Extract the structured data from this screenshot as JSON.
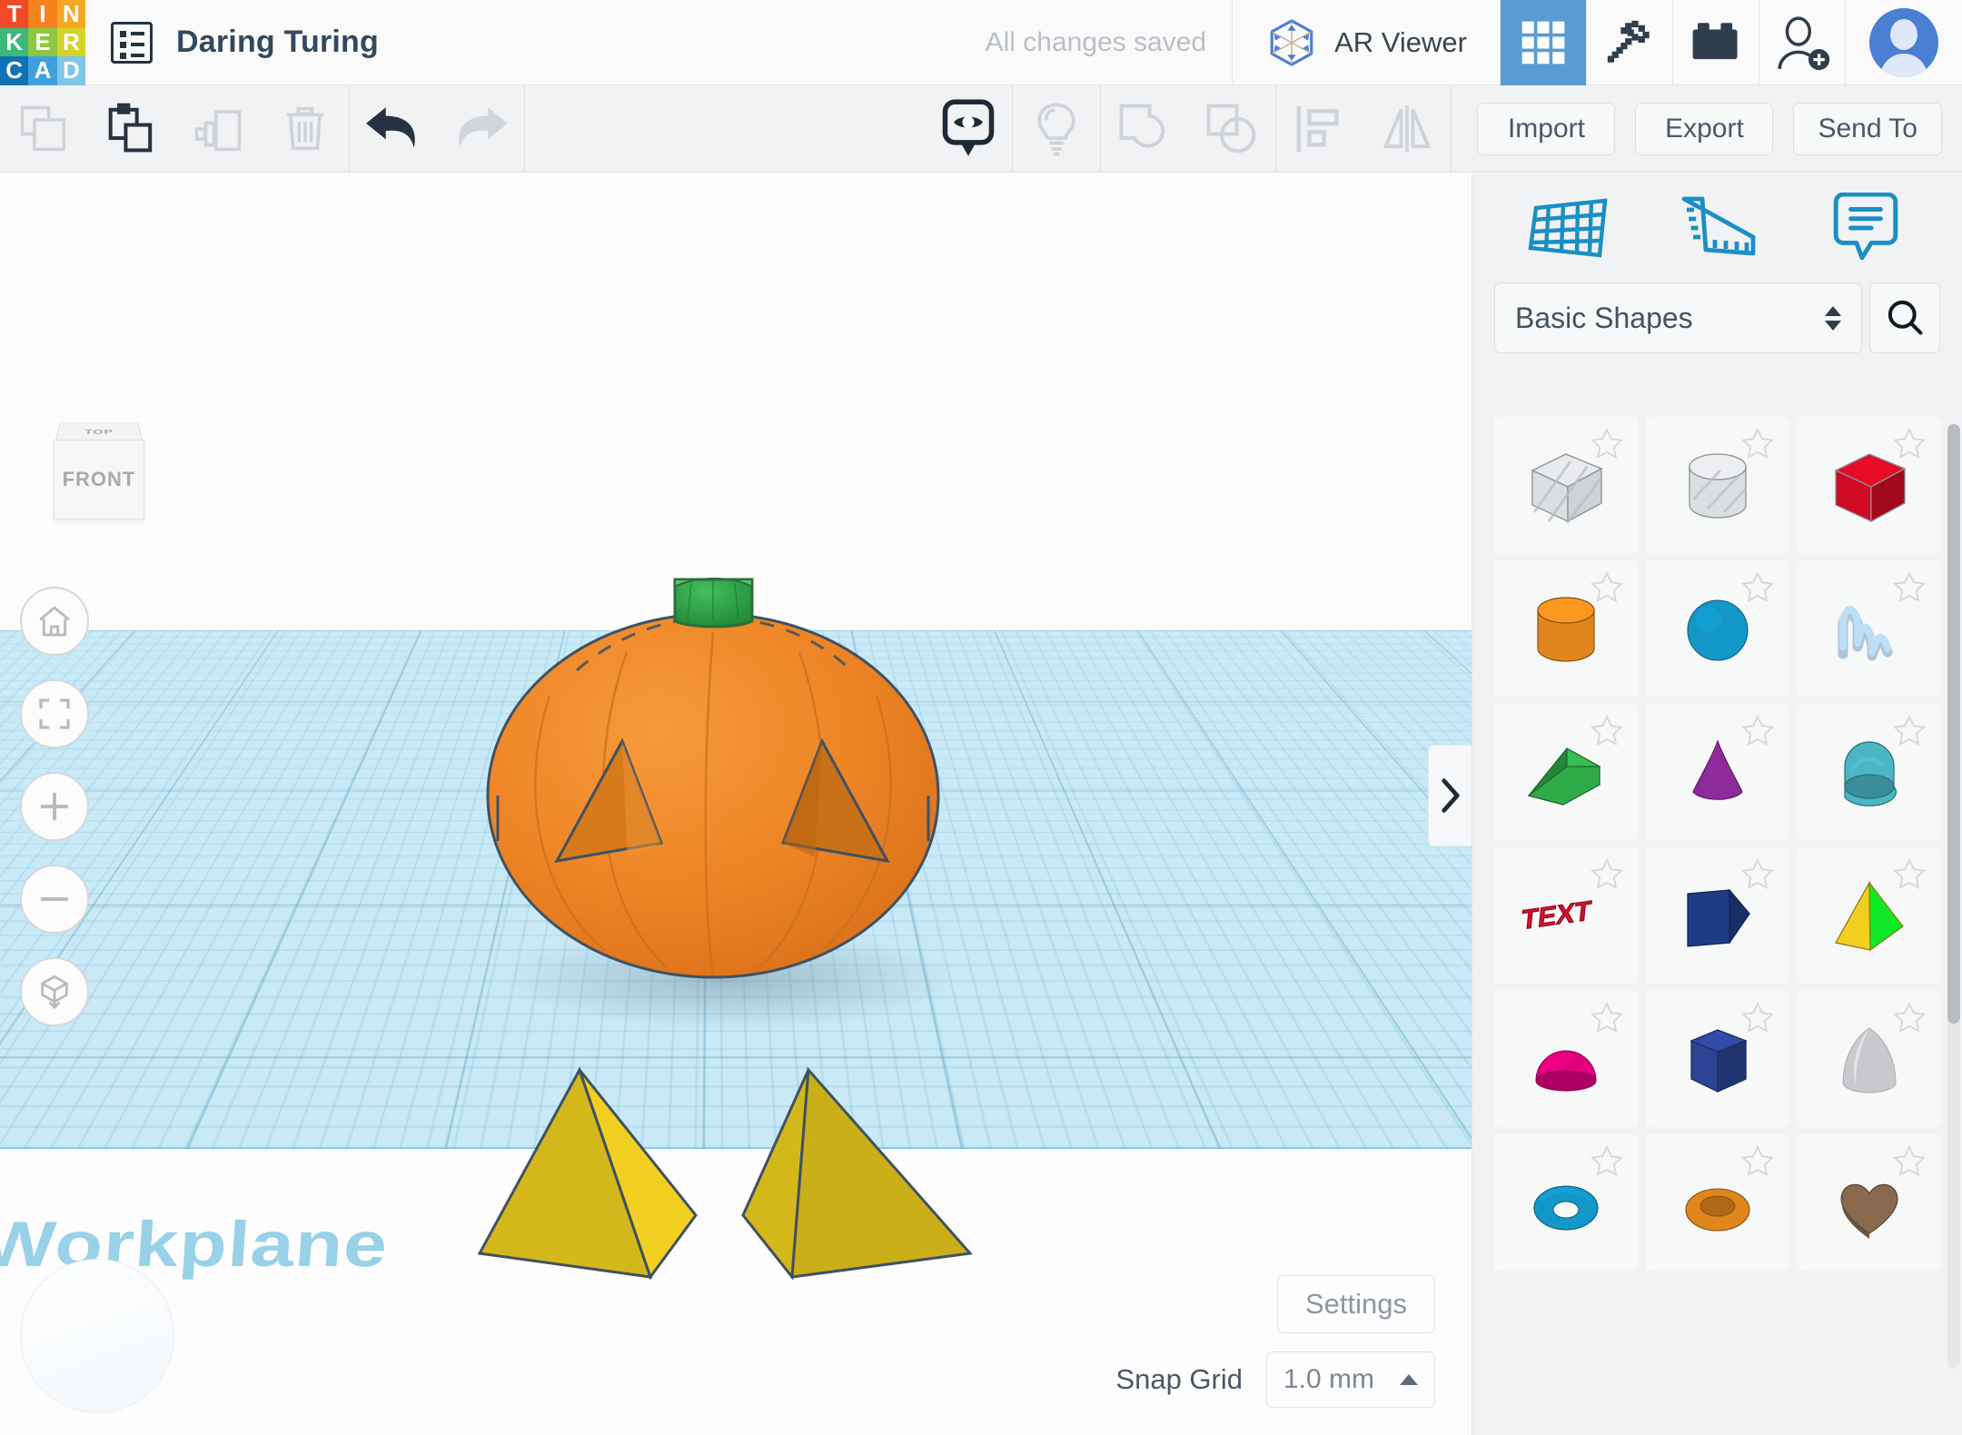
{
  "app": {
    "logo_tiles": [
      {
        "letter": "T",
        "color": "#f04b29"
      },
      {
        "letter": "I",
        "color": "#f7821e"
      },
      {
        "letter": "N",
        "color": "#f5a623"
      },
      {
        "letter": "K",
        "color": "#3cb878"
      },
      {
        "letter": "E",
        "color": "#8dc63f"
      },
      {
        "letter": "R",
        "color": "#d4d32a"
      },
      {
        "letter": "C",
        "color": "#0f72b5"
      },
      {
        "letter": "A",
        "color": "#3fa0db"
      },
      {
        "letter": "D",
        "color": "#7fc6e8"
      }
    ],
    "accent_blue": "#1b8fc4",
    "highlight_blue": "#5b9bd5"
  },
  "header": {
    "project_title": "Daring Turing",
    "save_status": "All changes saved",
    "ar_viewer_label": "AR Viewer",
    "icons": {
      "menu": "list-menu-icon",
      "ar": "ar-viewer-icon",
      "blocks": "blocks-grid-icon",
      "minecraft": "minecraft-pickaxe-icon",
      "lego": "lego-brick-icon",
      "add_user": "add-user-icon",
      "avatar": "user-avatar"
    }
  },
  "toolbar": {
    "left_tools": [
      {
        "name": "copy-icon",
        "enabled": false
      },
      {
        "name": "paste-icon",
        "enabled": true
      },
      {
        "name": "duplicate-icon",
        "enabled": false
      },
      {
        "name": "delete-icon",
        "enabled": false
      }
    ],
    "history_tools": [
      {
        "name": "undo-icon",
        "enabled": true
      },
      {
        "name": "redo-icon",
        "enabled": false
      }
    ],
    "view_tools": [
      {
        "name": "show-hide-icon",
        "enabled": true
      },
      {
        "name": "light-bulb-icon",
        "enabled": false
      }
    ],
    "group_tools": [
      {
        "name": "group-icon",
        "enabled": false
      },
      {
        "name": "ungroup-icon",
        "enabled": false
      }
    ],
    "align_tools": [
      {
        "name": "align-icon",
        "enabled": false
      },
      {
        "name": "mirror-icon",
        "enabled": false
      }
    ],
    "import_label": "Import",
    "export_label": "Export",
    "send_to_label": "Send To"
  },
  "canvas": {
    "view_cube": {
      "top_face": "TOP",
      "front_face": "FRONT"
    },
    "workplane_label": "Workplane",
    "nav_buttons": [
      {
        "name": "home-view-icon"
      },
      {
        "name": "fit-to-view-icon"
      },
      {
        "name": "zoom-in-icon"
      },
      {
        "name": "zoom-out-icon"
      },
      {
        "name": "orthographic-toggle-icon"
      }
    ],
    "objects": [
      {
        "name": "pumpkin",
        "body_color": "#ef8526",
        "stem_color": "#2fa84a",
        "features": "two triangular eye holes"
      },
      {
        "name": "pyramid-left",
        "color": "#f2d021"
      },
      {
        "name": "pyramid-right",
        "color": "#d4b81b"
      }
    ],
    "settings_label": "Settings",
    "snap_grid_label": "Snap Grid",
    "snap_grid_value": "1.0 mm",
    "collapse_icon": "chevron-right-icon"
  },
  "panel": {
    "tabs": [
      {
        "name": "workplane-tab",
        "icon": "workplane-grid-icon"
      },
      {
        "name": "ruler-tab",
        "icon": "ruler-icon"
      },
      {
        "name": "notes-tab",
        "icon": "notes-comment-icon"
      }
    ],
    "category_value": "Basic Shapes",
    "search_icon": "search-icon",
    "shapes": [
      {
        "label": "Box Hole",
        "kind": "hole-box",
        "color": "#d7dadd"
      },
      {
        "label": "Cylinder Hole",
        "kind": "hole-cylinder",
        "color": "#d7dadd"
      },
      {
        "label": "Box",
        "kind": "box",
        "color": "#cf0a24"
      },
      {
        "label": "Cylinder",
        "kind": "cylinder",
        "color": "#e0861c"
      },
      {
        "label": "Sphere",
        "kind": "sphere",
        "color": "#1397c8"
      },
      {
        "label": "Scribble",
        "kind": "scribble",
        "color": "#aac6db"
      },
      {
        "label": "Roof",
        "kind": "wedge",
        "color": "#2fab49"
      },
      {
        "label": "Cone",
        "kind": "cone",
        "color": "#8e2a9a"
      },
      {
        "label": "Tube",
        "kind": "halftube",
        "color": "#4ab6c4"
      },
      {
        "label": "Text",
        "kind": "text",
        "color": "#d6112a"
      },
      {
        "label": "Polygon Wedge",
        "kind": "polyslab",
        "color": "#1f3b86"
      },
      {
        "label": "Pyramid",
        "kind": "pyramid",
        "color": "#f2d021"
      },
      {
        "label": "Half Sphere",
        "kind": "halfsphere",
        "color": "#e3007f"
      },
      {
        "label": "Hexagon Prism",
        "kind": "hexprism",
        "color": "#2b4494"
      },
      {
        "label": "Paraboloid",
        "kind": "paraboloid",
        "color": "#c7c9cc"
      },
      {
        "label": "Torus",
        "kind": "torus",
        "color": "#1397c8"
      },
      {
        "label": "Round Roof",
        "kind": "ring",
        "color": "#e0861c"
      },
      {
        "label": "Heart",
        "kind": "heart",
        "color": "#8a6a4f"
      }
    ]
  }
}
